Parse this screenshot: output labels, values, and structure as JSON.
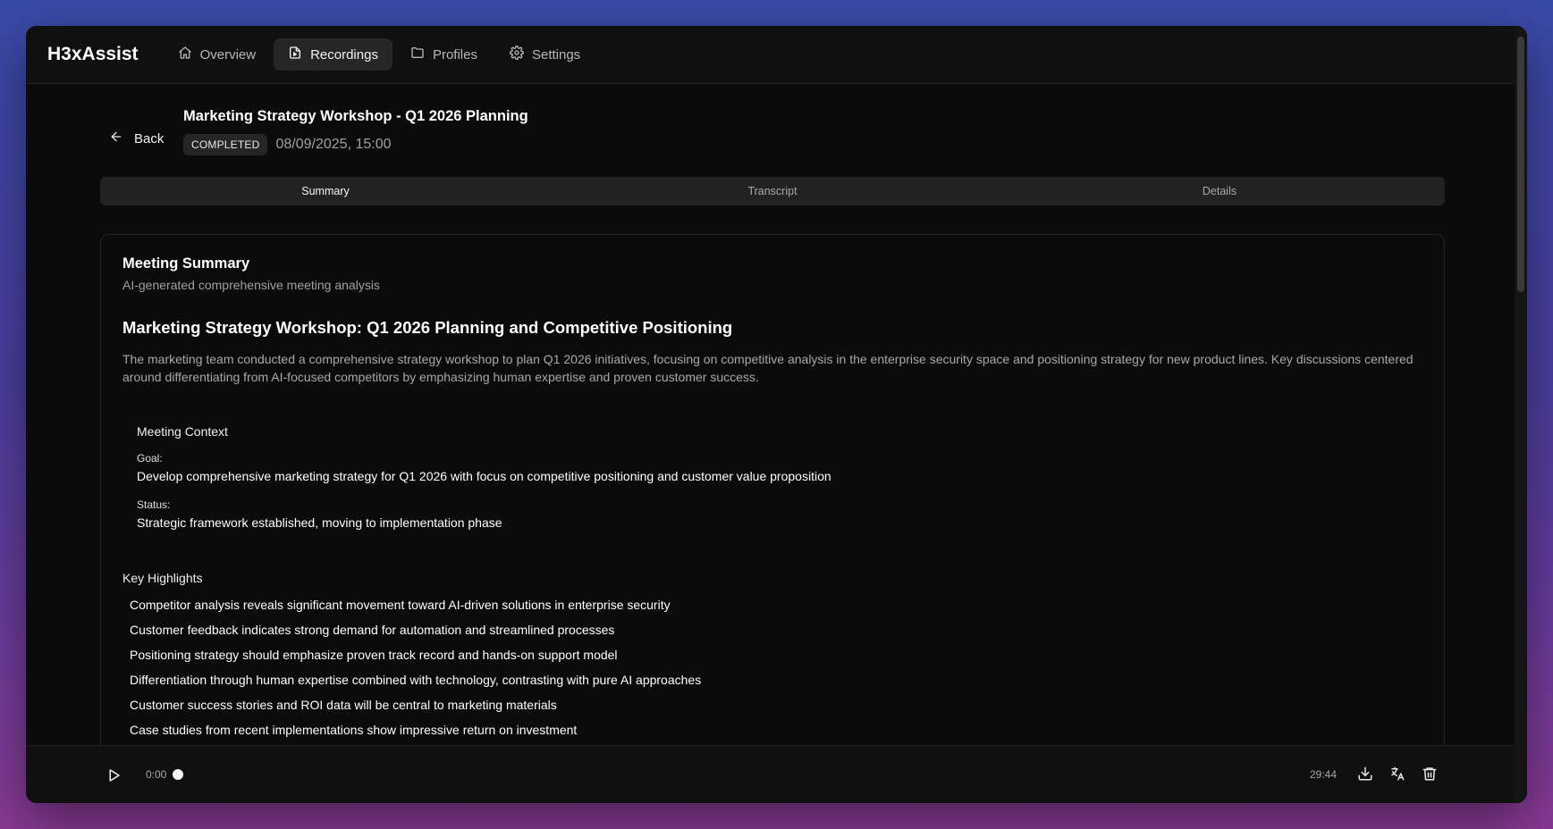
{
  "app": {
    "name": "H3xAssist"
  },
  "nav": {
    "items": [
      {
        "label": "Overview",
        "icon": "home-icon"
      },
      {
        "label": "Recordings",
        "icon": "file-audio-icon",
        "active": true
      },
      {
        "label": "Profiles",
        "icon": "folder-icon"
      },
      {
        "label": "Settings",
        "icon": "gear-icon"
      }
    ]
  },
  "header": {
    "back_label": "Back",
    "title": "Marketing Strategy Workshop - Q1 2026 Planning",
    "status": "COMPLETED",
    "datetime": "08/09/2025, 15:00"
  },
  "tabs": [
    {
      "label": "Summary",
      "active": true
    },
    {
      "label": "Transcript"
    },
    {
      "label": "Details"
    }
  ],
  "summary": {
    "card_title": "Meeting Summary",
    "card_subtitle": "AI-generated comprehensive meeting analysis",
    "heading": "Marketing Strategy Workshop: Q1 2026 Planning and Competitive Positioning",
    "paragraph": "The marketing team conducted a comprehensive strategy workshop to plan Q1 2026 initiatives, focusing on competitive analysis in the enterprise security space and positioning strategy for new product lines. Key discussions centered around differentiating from AI-focused competitors by emphasizing human expertise and proven customer success.",
    "context": {
      "title": "Meeting Context",
      "goal_label": "Goal:",
      "goal": "Develop comprehensive marketing strategy for Q1 2026 with focus on competitive positioning and customer value proposition",
      "status_label": "Status:",
      "status": "Strategic framework established, moving to implementation phase"
    },
    "highlights_title": "Key Highlights",
    "highlights": [
      "Competitor analysis reveals significant movement toward AI-driven solutions in enterprise security",
      "Customer feedback indicates strong demand for automation and streamlined processes",
      "Positioning strategy should emphasize proven track record and hands-on support model",
      "Differentiation through human expertise combined with technology, contrasting with pure AI approaches",
      "Customer success stories and ROI data will be central to marketing materials",
      "Case studies from recent implementations show impressive return on investment"
    ]
  },
  "player": {
    "current_time": "0:00",
    "total_time": "29:44",
    "progress": 0,
    "actions": [
      "download-icon",
      "translate-icon",
      "trash-icon"
    ]
  },
  "colors": {
    "background_gradient": [
      "#3a4aa8",
      "#8a3a94"
    ],
    "window": "#0b0b0b",
    "panel": "#101010",
    "accent_active": "#262626"
  }
}
